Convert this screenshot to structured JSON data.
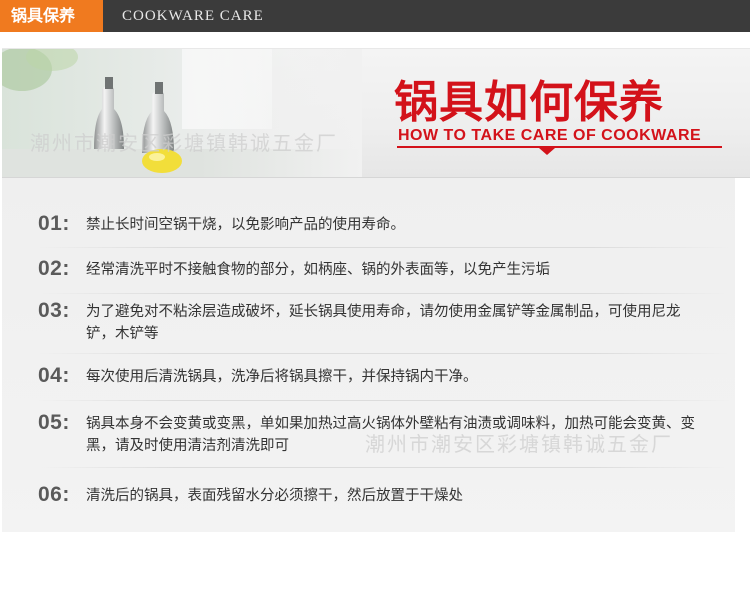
{
  "header": {
    "tag": "锅具保养",
    "subtitle": "COOKWARE CARE"
  },
  "banner": {
    "title_cn": "锅具如何保养",
    "title_en": "HOW TO TAKE CARE OF COOKWARE",
    "watermark": "潮州市潮安区彩塘镇韩诚五金厂"
  },
  "tips": [
    {
      "num": "01:",
      "text": "禁止长时间空锅干烧，以免影响产品的使用寿命。"
    },
    {
      "num": "02:",
      "text": "经常清洗平时不接触食物的部分，如柄座、锅的外表面等，以免产生污垢"
    },
    {
      "num": "03:",
      "text": "为了避免对不粘涂层造成破坏，延长锅具使用寿命，请勿使用金属铲等金属制品，可使用尼龙铲，木铲等"
    },
    {
      "num": "04:",
      "text": "每次使用后清洗锅具，洗净后将锅具擦干，并保持锅内干净。"
    },
    {
      "num": "05:",
      "text": "锅具本身不会变黄或变黑，单如果加热过高火锅体外壁粘有油渍或调味料，加热可能会变黄、变黑，请及时使用清洁剂清洗即可"
    },
    {
      "num": "06:",
      "text": "清洗后的锅具，表面残留水分必须擦干，然后放置于干燥处"
    }
  ],
  "colors": {
    "accent_orange": "#f07a1f",
    "title_red": "#d3121a",
    "header_dark": "#3b3b3b"
  }
}
